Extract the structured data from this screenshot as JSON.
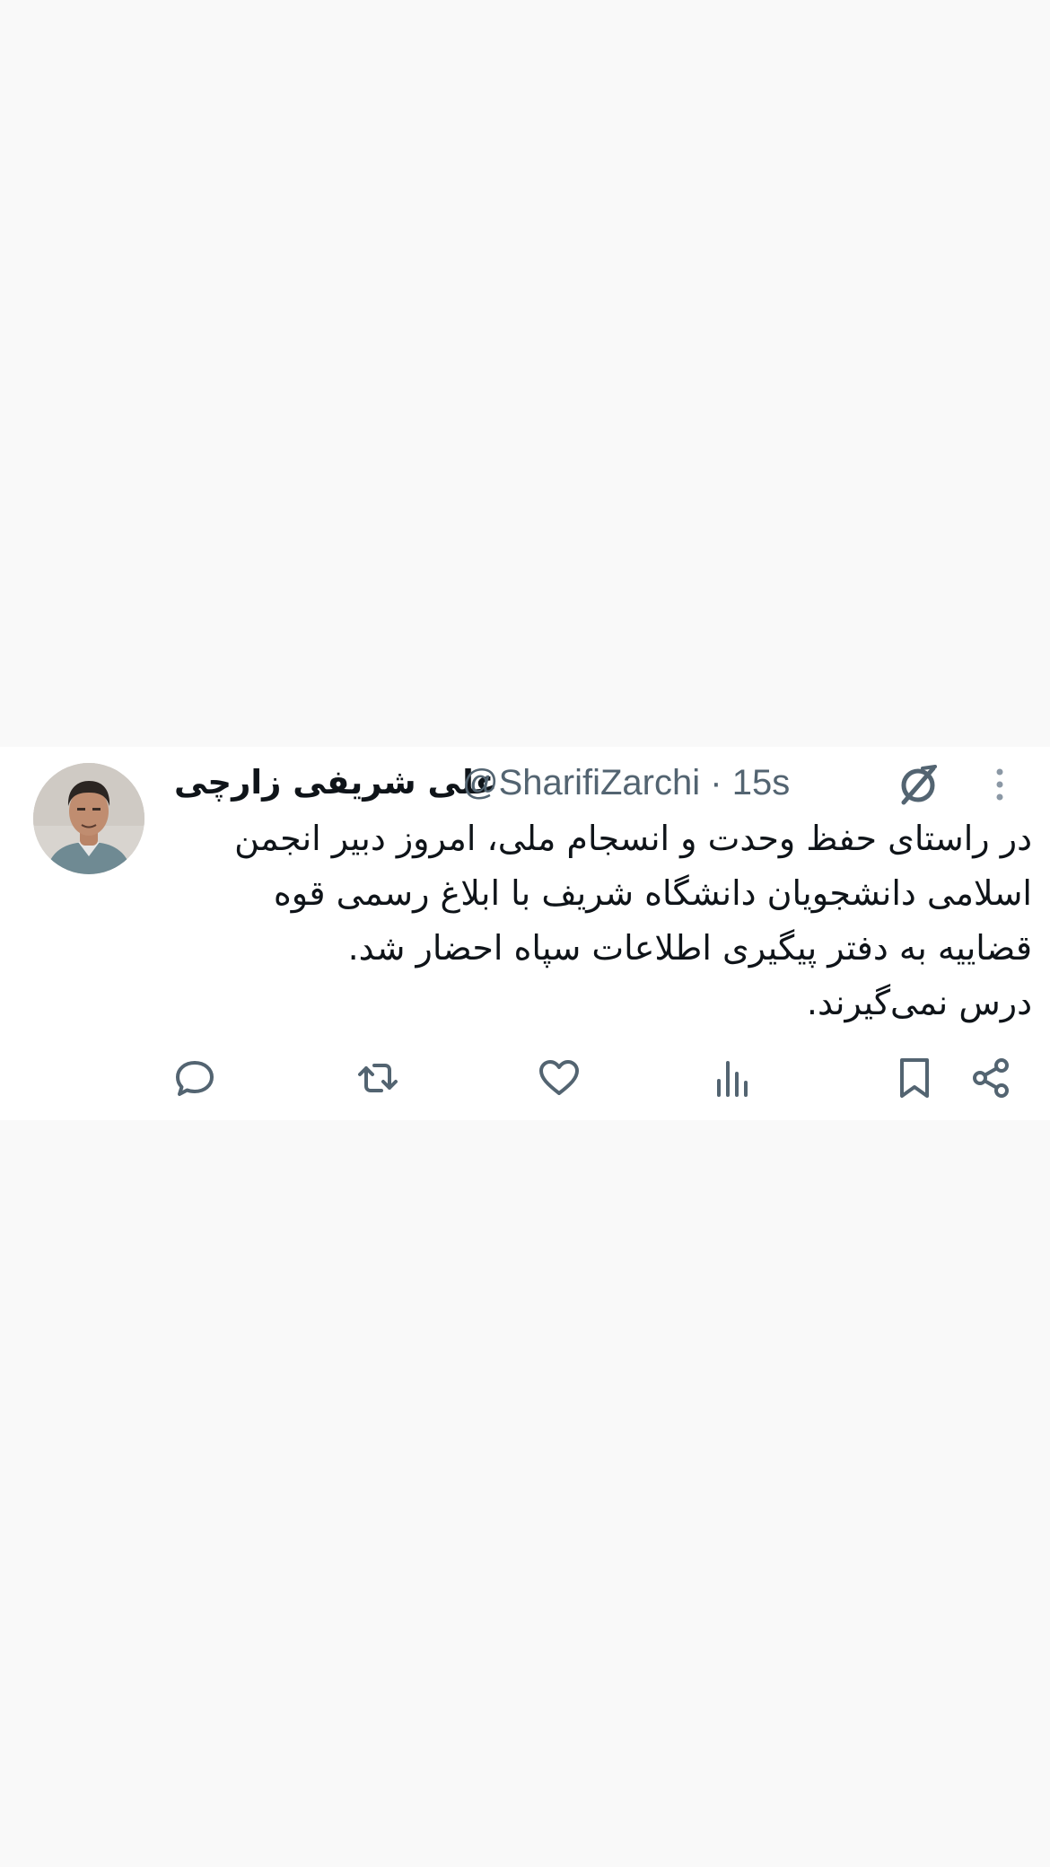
{
  "tweet": {
    "author": {
      "display_name": "علی شریفی زارچی",
      "handle": "@SharifiZarchi",
      "avatar_icon": "user-photo"
    },
    "timestamp": "15s",
    "separator": "·",
    "body_lines": [
      "در راستای حفظ وحدت و انسجام ملی، امروز دبیر انجمن",
      "اسلامی دانشجویان دانشگاه شریف با ابلاغ رسمی قوه",
      "قضاییه به دفتر پیگیری اطلاعات سپاه احضار شد.",
      "درس نمی‌گیرند."
    ],
    "icons": {
      "grok": "grok-icon",
      "more": "more-vertical-icon"
    }
  },
  "actions": [
    {
      "name": "reply",
      "icon": "reply-icon"
    },
    {
      "name": "retweet",
      "icon": "retweet-icon"
    },
    {
      "name": "like",
      "icon": "heart-icon"
    },
    {
      "name": "views",
      "icon": "views-icon"
    },
    {
      "name": "bookmark",
      "icon": "bookmark-icon"
    },
    {
      "name": "share",
      "icon": "share-icon"
    }
  ],
  "colors": {
    "page_background": "#f9f9f9",
    "card_background": "#ffffff",
    "text_primary": "#0f1419",
    "text_secondary": "#536471"
  }
}
